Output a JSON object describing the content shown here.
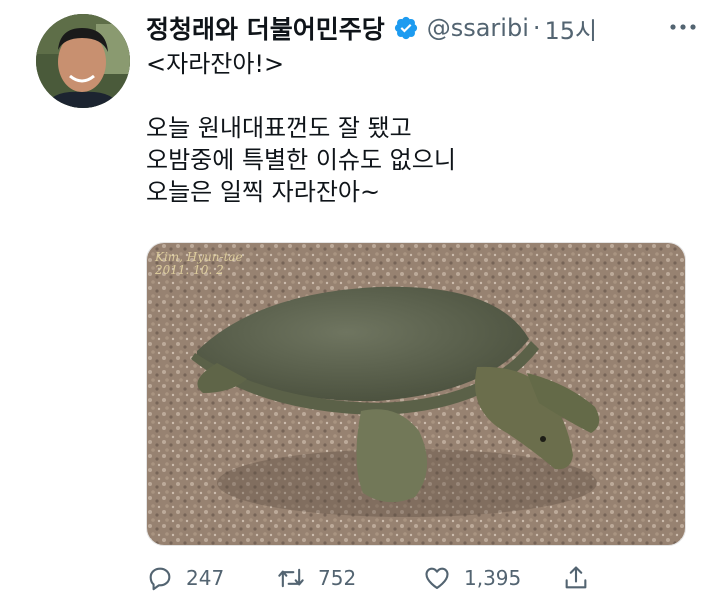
{
  "author": {
    "display_name": "정청래와 더불어민주당",
    "handle": "@ssaribi",
    "separator": "·",
    "timestamp": "15시",
    "verified": true,
    "avatar_icon": "avatar-photo"
  },
  "tweet": {
    "lines": [
      "<자라잔아!>",
      "",
      "오늘 원내대표껀도 잘 됐고",
      "오밤중에 특별한 이슈도 없으니",
      "오늘은 일찍 자라잔아~"
    ]
  },
  "media": {
    "watermark_line1": "Kim, Hyun-tae",
    "watermark_line2": "2011. 10. 2"
  },
  "actions": {
    "reply_count": "247",
    "retweet_count": "752",
    "like_count": "1,395"
  },
  "colors": {
    "text": "#0f1419",
    "secondary": "#536471",
    "verified": "#1d9bf0"
  }
}
